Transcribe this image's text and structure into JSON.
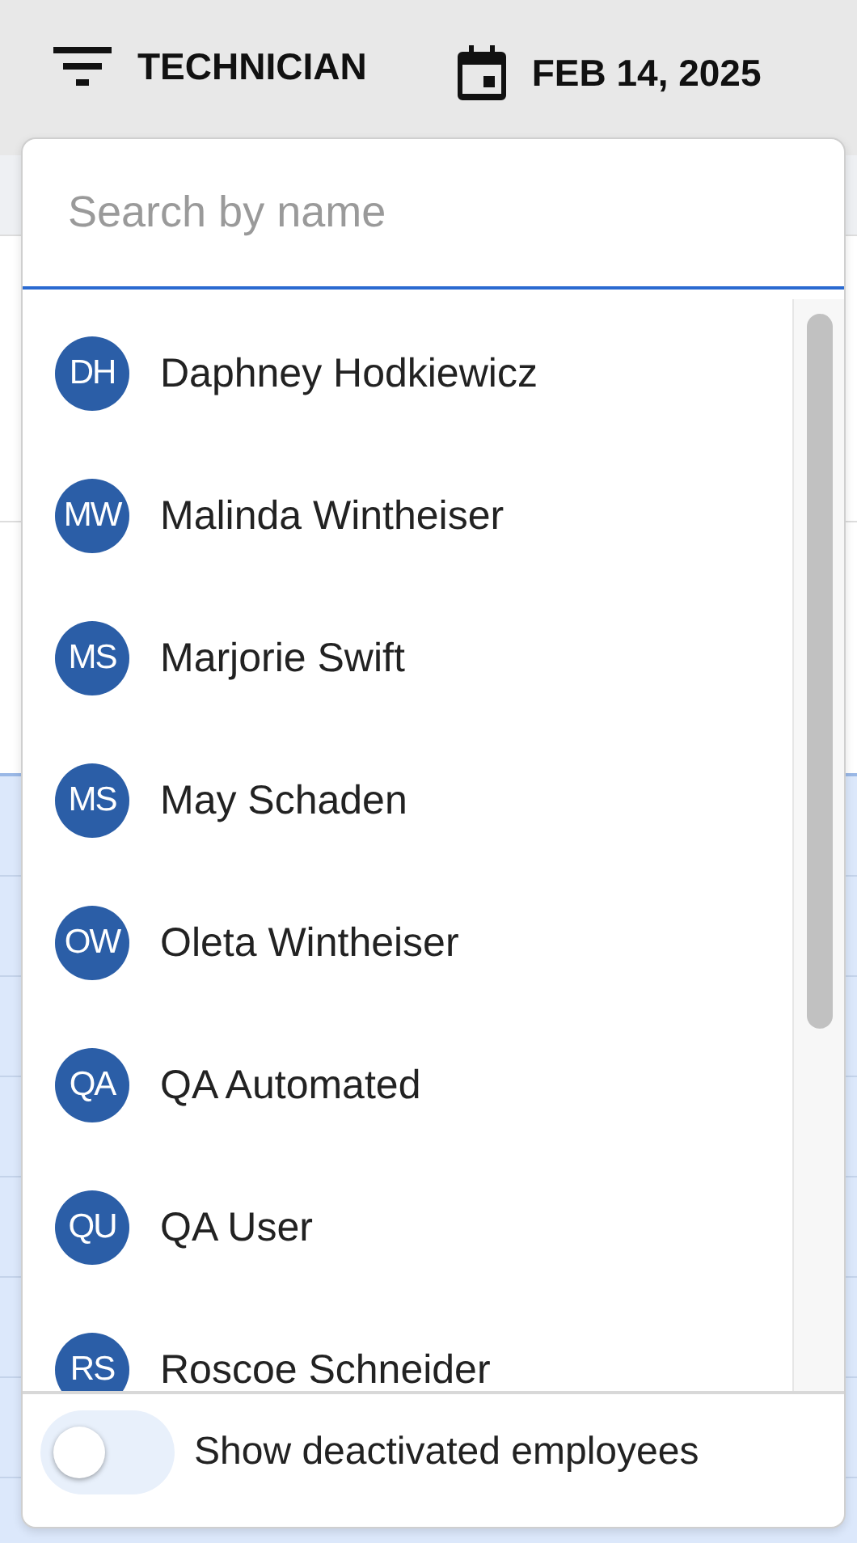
{
  "toolbar": {
    "filter_label": "TECHNICIAN",
    "date": "FEB 14, 2025"
  },
  "dropdown": {
    "search": {
      "placeholder": "Search by name"
    },
    "employees": [
      {
        "initials": "DH",
        "name": "Daphney Hodkiewicz"
      },
      {
        "initials": "MW",
        "name": "Malinda Wintheiser"
      },
      {
        "initials": "MS",
        "name": "Marjorie Swift"
      },
      {
        "initials": "MS",
        "name": "May Schaden"
      },
      {
        "initials": "OW",
        "name": "Oleta Wintheiser"
      },
      {
        "initials": "QA",
        "name": "QA Automated"
      },
      {
        "initials": "QU",
        "name": "QA User"
      },
      {
        "initials": "RS",
        "name": "Roscoe Schneider"
      }
    ],
    "show_deactivated": {
      "label": "Show deactivated employees",
      "on": false
    }
  }
}
